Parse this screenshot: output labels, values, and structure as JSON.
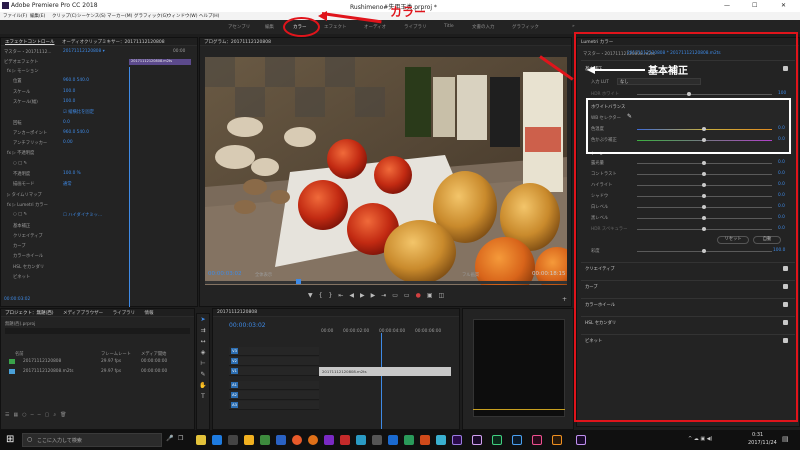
{
  "window": {
    "app_title": "Adobe Premiere Pro CC 2018",
    "project_path": "Rushimeno#失用玉类.prproj *",
    "controls": [
      "—",
      "☐",
      "✕"
    ]
  },
  "menu": [
    "ファイル(F)",
    "編集(E)",
    "クリップ(C)",
    "シーケンス(S)",
    "マーカー(M)",
    "グラフィック(G)",
    "ウィンドウ(W)",
    "ヘルプ(H)"
  ],
  "workspaces": [
    {
      "label": "アセンブリ",
      "active": false
    },
    {
      "label": "編集",
      "active": false
    },
    {
      "label": "カラー",
      "active": true
    },
    {
      "label": "エフェクト",
      "active": false
    },
    {
      "label": "オーディオ",
      "active": false
    },
    {
      "label": "ライブラリ",
      "active": false
    },
    {
      "label": "Title",
      "active": false
    },
    {
      "label": "文書の入力",
      "active": false
    },
    {
      "label": "グラフィック",
      "active": false
    }
  ],
  "workspace_more": "»",
  "annotations": {
    "color_label": "カラー",
    "basic_label": "基本補正",
    "accent": "#e0141b"
  },
  "effect_controls": {
    "tabs": [
      "エフェクトコントロール",
      "オーディオクリップミキサー：20171112120808"
    ],
    "master": "マスター・20171112...",
    "clip": "20171112120808 ▾",
    "timecode_start": "00:00",
    "clip_bar": "20171112120808.m2ts",
    "section_video": "ビデオエフェクト",
    "items": [
      {
        "label": "fx ▷ モーション",
        "value": "",
        "indent": 0
      },
      {
        "label": "位置",
        "value": "960.0   540.0",
        "indent": 2
      },
      {
        "label": "スケール",
        "value": "100.0",
        "indent": 2
      },
      {
        "label": "スケール(幅)",
        "value": "100.0",
        "indent": 2
      },
      {
        "label": "",
        "value": "☑ 縦横比を固定",
        "indent": 4
      },
      {
        "label": "回転",
        "value": "0.0",
        "indent": 2
      },
      {
        "label": "アンカーポイント",
        "value": "960.0   540.0",
        "indent": 2
      },
      {
        "label": "アンチフリッカー",
        "value": "0.00",
        "indent": 2
      },
      {
        "label": "fx ▷ 不透明度",
        "value": "",
        "indent": 0
      },
      {
        "label": "○ □ ✎",
        "value": "",
        "indent": 2
      },
      {
        "label": "不透明度",
        "value": "100.0 %",
        "indent": 2
      },
      {
        "label": "描画モード",
        "value": "通常",
        "indent": 2
      },
      {
        "label": "▷ タイムリマップ",
        "value": "",
        "indent": 0
      },
      {
        "label": "fx ▷ Lumetri カラー",
        "value": "",
        "indent": 0
      },
      {
        "label": "○ □ ✎",
        "value": "☐ ハイダイナミッ...",
        "indent": 2
      },
      {
        "label": "基本補正",
        "value": "",
        "indent": 2
      },
      {
        "label": "クリエイティブ",
        "value": "",
        "indent": 2
      },
      {
        "label": "カーブ",
        "value": "",
        "indent": 2
      },
      {
        "label": "カラーホイール",
        "value": "",
        "indent": 2
      },
      {
        "label": "HSL セカンダリ",
        "value": "",
        "indent": 2
      },
      {
        "label": "ビネット",
        "value": "",
        "indent": 2
      }
    ],
    "footer_tc": "00:00:03:02"
  },
  "program": {
    "title": "プログラム：20171112120808",
    "timecode": "00:00:03:02",
    "fit": "全体表示",
    "quality": "フル画質",
    "duration": "00:00:18:15"
  },
  "project": {
    "tabs": [
      "プロジェクト：無題(西)",
      "メディアブラウザー",
      "ライブラリ",
      "情報"
    ],
    "filename": "無題(西).prproj",
    "headers": [
      "名前",
      "フレームレート",
      "メディア開始"
    ],
    "rows": [
      {
        "name": "20171112120808",
        "fps": "29.97 fps",
        "start": "00:00:00:00",
        "color": "#3aa34a"
      },
      {
        "name": "20171112120808.m2ts",
        "fps": "29.97 fps",
        "start": "00:00:00:00",
        "color": "#4aa0d8"
      }
    ]
  },
  "timeline": {
    "title": "20171112120808",
    "timecode": "00:00:03:02",
    "ruler": [
      "00:00",
      "00:00:02:00",
      "00:00:04:00",
      "00:00:06:00",
      "00:00:08:00"
    ],
    "video_tracks": [
      "V3",
      "V2",
      "V1"
    ],
    "audio_tracks": [
      "A1",
      "A2",
      "A3"
    ],
    "clip_name": "20171112120808.m2ts"
  },
  "lumetri": {
    "title": "Lumetri カラー",
    "master": "マスター・20171112120808.m2ts",
    "seq": "20171112120808 * 20171112120808.m2ts",
    "section": "基本補正",
    "input_lut_label": "入力 LUT",
    "input_lut_value": "なし",
    "hdr_label": "HDR ホワイト",
    "hdr_value": "100",
    "wb_title": "ホワイトバランス",
    "wb_selector": "WB セレクター",
    "temp_label": "色温度",
    "temp_value": "0.0",
    "tint_label": "色かぶり補正",
    "tint_value": "0.0",
    "tone_title": "トーン",
    "tone": [
      {
        "label": "露光量",
        "value": "0.0"
      },
      {
        "label": "コントラスト",
        "value": "0.0"
      },
      {
        "label": "ハイライト",
        "value": "0.0"
      },
      {
        "label": "シャドウ",
        "value": "0.0"
      },
      {
        "label": "白レベル",
        "value": "0.0"
      },
      {
        "label": "黒レベル",
        "value": "0.0"
      },
      {
        "label": "HDR スペキュラー",
        "value": "0.0"
      }
    ],
    "reset_button": "リセット",
    "auto_button": "自動",
    "saturation_label": "彩度",
    "saturation_value": "100.0",
    "sections": [
      "クリエイティブ",
      "カーブ",
      "カラーホイール",
      "HSL セカンダリ",
      "ビネット"
    ]
  },
  "taskbar": {
    "search_placeholder": "ここに入力して検索",
    "time": "0:31",
    "date": "2017/11/24"
  }
}
